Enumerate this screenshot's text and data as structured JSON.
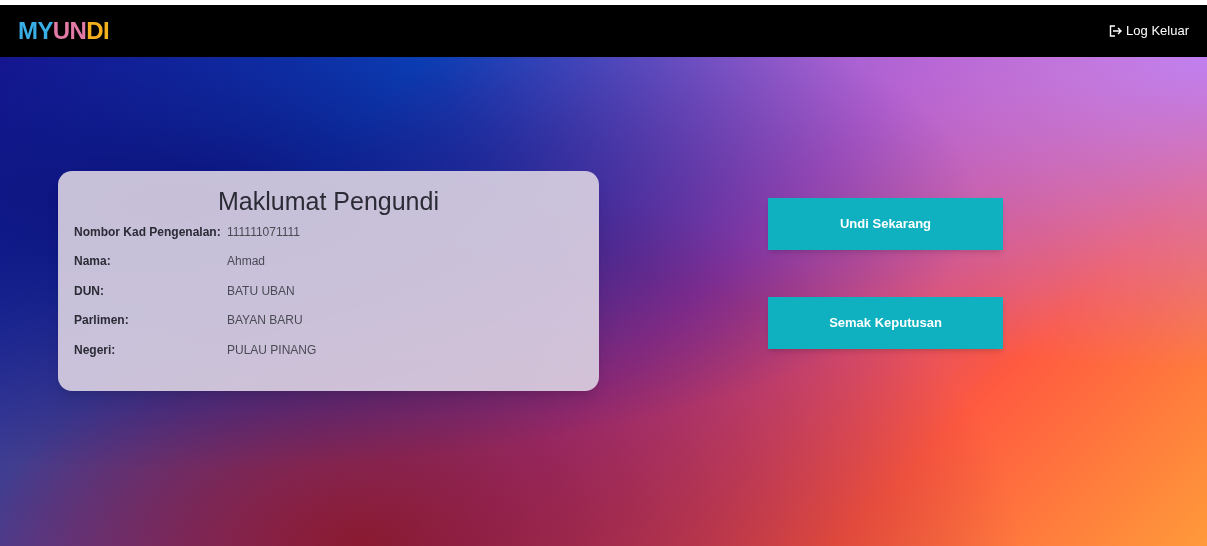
{
  "navbar": {
    "logo": [
      {
        "text": "MY",
        "color": "#3aaee6"
      },
      {
        "text": "UN",
        "color": "#e27aa6"
      },
      {
        "text": "DI",
        "color": "#f2b01e"
      }
    ],
    "logout": {
      "label": "Log Keluar"
    }
  },
  "card": {
    "title": "Maklumat Pengundi",
    "rows": [
      {
        "label": "Nombor Kad Pengenalan:",
        "value": "111111071111"
      },
      {
        "label": "Nama:",
        "value": "Ahmad"
      },
      {
        "label": "DUN:",
        "value": "BATU UBAN"
      },
      {
        "label": "Parlimen:",
        "value": "BAYAN BARU"
      },
      {
        "label": "Negeri:",
        "value": "PULAU PINANG"
      }
    ]
  },
  "actions": [
    "Undi Sekarang",
    "Semak Keputusan"
  ]
}
